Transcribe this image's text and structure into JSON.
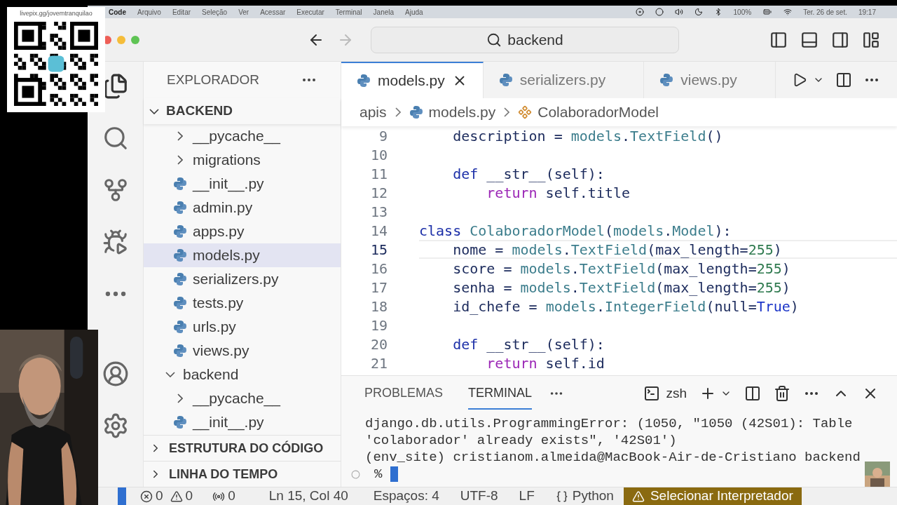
{
  "menu_bar": {
    "app": "Code",
    "items": [
      "Arquivo",
      "Editar",
      "Seleção",
      "Ver",
      "Acessar",
      "Executar",
      "Terminal",
      "Janela",
      "Ajuda"
    ],
    "battery": "100%",
    "date": "Ter. 26 de set.",
    "time": "19:17"
  },
  "qr_overlay": {
    "caption": "livepix.gg/jovemtranquilao"
  },
  "window": {
    "search": "backend"
  },
  "explorer": {
    "title": "EXPLORADOR",
    "root": "BACKEND",
    "tree": [
      {
        "children": [
          {
            "label": "__pycache__",
            "kind": "folder",
            "expanded": false,
            "selected": false
          },
          {
            "label": "migrations",
            "kind": "folder",
            "expanded": false,
            "selected": false
          },
          {
            "label": "__init__.py",
            "kind": "file",
            "selected": false
          },
          {
            "label": "admin.py",
            "kind": "file",
            "selected": false
          },
          {
            "label": "apps.py",
            "kind": "file",
            "selected": false
          },
          {
            "label": "models.py",
            "kind": "file",
            "selected": true
          },
          {
            "label": "serializers.py",
            "kind": "file",
            "selected": false
          },
          {
            "label": "tests.py",
            "kind": "file",
            "selected": false
          },
          {
            "label": "urls.py",
            "kind": "file",
            "selected": false
          },
          {
            "label": "views.py",
            "kind": "file",
            "selected": false
          }
        ]
      },
      {
        "label": "backend",
        "kind": "folder",
        "expanded": true,
        "selected": false,
        "children": [
          {
            "label": "__pycache__",
            "kind": "folder",
            "expanded": false,
            "selected": false
          },
          {
            "label": "__init__.py",
            "kind": "file",
            "selected": false
          }
        ]
      }
    ],
    "sections": [
      {
        "label": "ESTRUTURA DO CÓDIGO",
        "expanded": false
      },
      {
        "label": "LINHA DO TEMPO",
        "expanded": false
      }
    ]
  },
  "editor": {
    "tabs": [
      {
        "label": "models.py",
        "selected": true
      },
      {
        "label": "serializers.py",
        "selected": false
      },
      {
        "label": "views.py",
        "selected": false
      }
    ],
    "breadcrumb": [
      {
        "label": "apis",
        "kind": "folder"
      },
      {
        "label": "models.py",
        "kind": "file"
      },
      {
        "label": "ColaboradorModel",
        "kind": "class"
      }
    ],
    "lines": [
      {
        "number": "9",
        "selected": false,
        "tokens": [
          {
            "text": "    description",
            "kind": "var"
          },
          {
            "text": " = ",
            "kind": "punc"
          },
          {
            "text": "models",
            "kind": "cls"
          },
          {
            "text": ".",
            "kind": "punc"
          },
          {
            "text": "TextField",
            "kind": "cls"
          },
          {
            "text": "()",
            "kind": "punc"
          }
        ]
      },
      {
        "number": "10",
        "selected": false
      },
      {
        "number": "11",
        "selected": false,
        "tokens": [
          {
            "text": "    def",
            "kind": "storage"
          },
          {
            "text": " __str__(self):",
            "kind": "var"
          }
        ]
      },
      {
        "number": "12",
        "selected": false,
        "tokens": [
          {
            "text": "        return",
            "kind": "control"
          },
          {
            "text": " self.title",
            "kind": "var"
          }
        ]
      },
      {
        "number": "13",
        "selected": false
      },
      {
        "number": "14",
        "selected": false,
        "tokens": [
          {
            "text": "class",
            "kind": "storage"
          },
          {
            "text": " ColaboradorModel",
            "kind": "cls"
          },
          {
            "text": "(",
            "kind": "punc"
          },
          {
            "text": "models",
            "kind": "cls"
          },
          {
            "text": ".",
            "kind": "punc"
          },
          {
            "text": "Model",
            "kind": "cls"
          },
          {
            "text": "):",
            "kind": "punc"
          }
        ]
      },
      {
        "number": "15",
        "selected": true,
        "tokens": [
          {
            "text": "    nome",
            "kind": "var"
          },
          {
            "text": " = ",
            "kind": "punc"
          },
          {
            "text": "models",
            "kind": "cls"
          },
          {
            "text": ".",
            "kind": "punc"
          },
          {
            "text": "TextField",
            "kind": "cls"
          },
          {
            "text": "(",
            "kind": "punc"
          },
          {
            "text": "max_length",
            "kind": "var"
          },
          {
            "text": "=",
            "kind": "punc"
          },
          {
            "text": "255",
            "kind": "num"
          },
          {
            "text": ")",
            "kind": "punc"
          }
        ]
      },
      {
        "number": "16",
        "selected": false,
        "tokens": [
          {
            "text": "    score",
            "kind": "var"
          },
          {
            "text": " = ",
            "kind": "punc"
          },
          {
            "text": "models",
            "kind": "cls"
          },
          {
            "text": ".",
            "kind": "punc"
          },
          {
            "text": "TextField",
            "kind": "cls"
          },
          {
            "text": "(",
            "kind": "punc"
          },
          {
            "text": "max_length",
            "kind": "var"
          },
          {
            "text": "=",
            "kind": "punc"
          },
          {
            "text": "255",
            "kind": "num"
          },
          {
            "text": ")",
            "kind": "punc"
          }
        ]
      },
      {
        "number": "17",
        "selected": false,
        "tokens": [
          {
            "text": "    senha",
            "kind": "var"
          },
          {
            "text": " = ",
            "kind": "punc"
          },
          {
            "text": "models",
            "kind": "cls"
          },
          {
            "text": ".",
            "kind": "punc"
          },
          {
            "text": "TextField",
            "kind": "cls"
          },
          {
            "text": "(",
            "kind": "punc"
          },
          {
            "text": "max_length",
            "kind": "var"
          },
          {
            "text": "=",
            "kind": "punc"
          },
          {
            "text": "255",
            "kind": "num"
          },
          {
            "text": ")",
            "kind": "punc"
          }
        ]
      },
      {
        "number": "18",
        "selected": false,
        "tokens": [
          {
            "text": "    id_chefe",
            "kind": "var"
          },
          {
            "text": " = ",
            "kind": "punc"
          },
          {
            "text": "models",
            "kind": "cls"
          },
          {
            "text": ".",
            "kind": "punc"
          },
          {
            "text": "IntegerField",
            "kind": "cls"
          },
          {
            "text": "(",
            "kind": "punc"
          },
          {
            "text": "null",
            "kind": "var"
          },
          {
            "text": "=",
            "kind": "punc"
          },
          {
            "text": "True",
            "kind": "const"
          },
          {
            "text": ")",
            "kind": "punc"
          }
        ]
      },
      {
        "number": "19",
        "selected": false
      },
      {
        "number": "20",
        "selected": false,
        "tokens": [
          {
            "text": "    def",
            "kind": "storage"
          },
          {
            "text": " __str__(self):",
            "kind": "var"
          }
        ]
      },
      {
        "number": "21",
        "selected": false,
        "tokens": [
          {
            "text": "        return",
            "kind": "control"
          },
          {
            "text": " self.id",
            "kind": "var"
          }
        ]
      }
    ]
  },
  "panel": {
    "tabs": [
      {
        "label": "PROBLEMAS",
        "selected": false
      },
      {
        "label": "TERMINAL",
        "selected": true
      }
    ],
    "shell": "zsh",
    "output": [
      "django.db.utils.ProgrammingError: (1050, \"1050 (42S01): Table",
      "'colaborador' already exists\", '42S01')",
      "(env_site) cristianom.almeida@MacBook-Air-de-Cristiano backend"
    ],
    "prompt": "%"
  },
  "status_bar": {
    "errors": "0",
    "warnings": "0",
    "ports": "0",
    "position": "Ln 15, Col 40",
    "indent": "Espaços: 4",
    "encoding": "UTF-8",
    "eol": "LF",
    "language": "Python",
    "interpreter": "Selecionar Interpretador"
  }
}
